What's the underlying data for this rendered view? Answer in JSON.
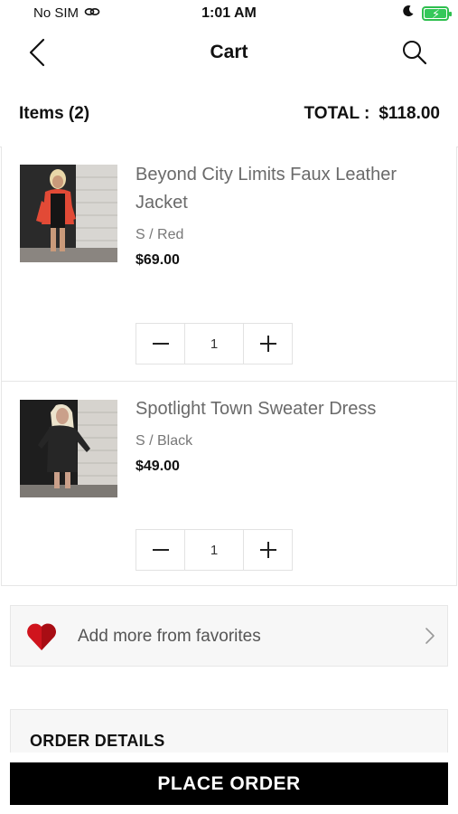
{
  "status_bar": {
    "carrier": "No SIM",
    "time": "1:01 AM"
  },
  "nav": {
    "title": "Cart"
  },
  "summary": {
    "items_label": "Items (2)",
    "total_label": "TOTAL :",
    "total_value": "$118.00"
  },
  "items": [
    {
      "name": "Beyond City Limits Faux Leather Jacket",
      "variant": "S / Red",
      "price": "$69.00",
      "quantity": "1"
    },
    {
      "name": "Spotlight Town Sweater Dress",
      "variant": "S / Black",
      "price": "$49.00",
      "quantity": "1"
    }
  ],
  "favorites": {
    "label": "Add more from favorites"
  },
  "order_details": {
    "title": "ORDER DETAILS"
  },
  "place_order": {
    "label": "PLACE ORDER"
  },
  "colors": {
    "accent": "#000000",
    "heart": "#d0141d",
    "battery": "#35c85a"
  }
}
